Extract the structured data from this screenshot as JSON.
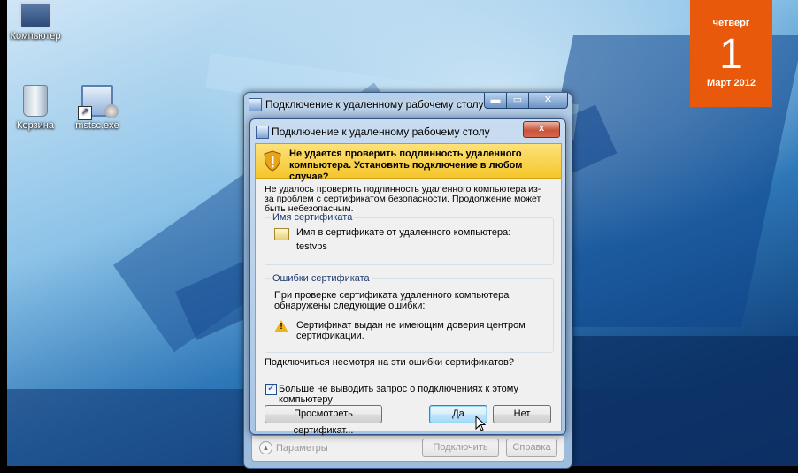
{
  "desktop": {
    "icons": [
      {
        "label": "Компьютер"
      },
      {
        "label": "Корзина"
      },
      {
        "label": "mstsc.exe"
      }
    ],
    "calendar": {
      "weekday": "четверг",
      "day": "1",
      "month": "Март 2012",
      "color": "#e8590c"
    }
  },
  "outer_window": {
    "title": "Подключение к удаленному рабочему столу",
    "parameters_label": "Параметры",
    "connect_button": "Подключить",
    "help_button": "Справка"
  },
  "dialog": {
    "title": "Подключение к удаленному рабочему столу",
    "close_label": "x",
    "warning_heading": "Не удается проверить подлинность удаленного компьютера. Установить подключение в любом случае?",
    "message": "Не удалось проверить подлинность удаленного компьютера из-за проблем с сертификатом безопасности. Продолжение может быть небезопасным.",
    "cert_name_group": {
      "legend": "Имя сертификата",
      "caption": "Имя в сертификате от удаленного компьютера:",
      "value": "testvps"
    },
    "cert_errors_group": {
      "legend": "Ошибки сертификата",
      "description": "При проверке сертификата удаленного компьютера обнаружены следующие ошибки:",
      "error": "Сертификат выдан не имеющим доверия центром сертификации."
    },
    "question": "Подключиться несмотря на эти ошибки сертификатов?",
    "dont_ask_checkbox": {
      "label": "Больше не выводить запрос о подключениях к этому компьютеру",
      "checked": true
    },
    "view_cert_button": "Просмотреть сертификат...",
    "yes_button": "Да",
    "no_button": "Нет"
  },
  "icons": {
    "window": "remote-desktop-icon",
    "warning": "shield-warning-icon",
    "certificate": "certificate-icon",
    "error": "warning-triangle-icon",
    "cursor": "mouse-pointer-icon"
  }
}
